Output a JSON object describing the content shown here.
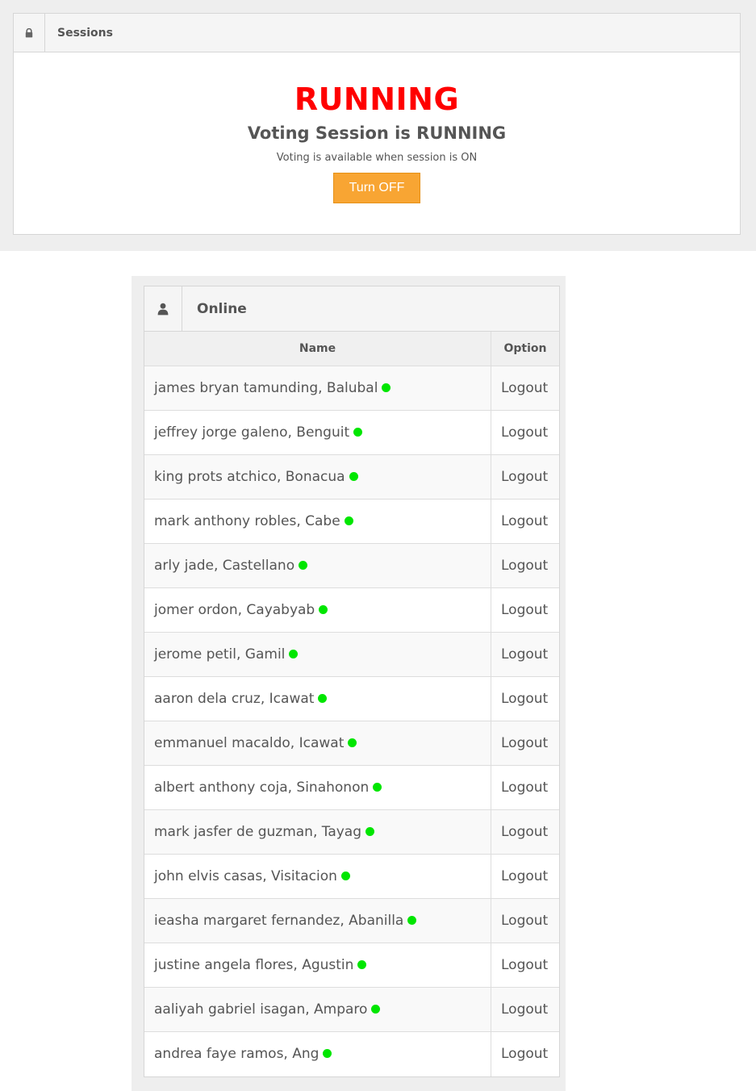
{
  "sessions": {
    "title": "Sessions",
    "status_big": "RUNNING",
    "status_line": "Voting Session is RUNNING",
    "hint": "Voting is available when session is ON",
    "toggle_label": "Turn OFF",
    "icon": "lock-icon"
  },
  "online": {
    "title": "Online",
    "icon": "user-icon",
    "columns": {
      "name": "Name",
      "option": "Option"
    },
    "rows": [
      {
        "name": "james bryan tamunding, Balubal",
        "option": "Logout"
      },
      {
        "name": "jeffrey jorge galeno, Benguit",
        "option": "Logout"
      },
      {
        "name": "king prots atchico, Bonacua",
        "option": "Logout"
      },
      {
        "name": "mark anthony robles, Cabe",
        "option": "Logout"
      },
      {
        "name": "arly jade, Castellano",
        "option": "Logout"
      },
      {
        "name": "jomer ordon, Cayabyab",
        "option": "Logout"
      },
      {
        "name": "jerome petil, Gamil",
        "option": "Logout"
      },
      {
        "name": "aaron dela cruz, Icawat",
        "option": "Logout"
      },
      {
        "name": "emmanuel macaldo, Icawat",
        "option": "Logout"
      },
      {
        "name": "albert anthony coja, Sinahonon",
        "option": "Logout"
      },
      {
        "name": "mark jasfer de guzman, Tayag",
        "option": "Logout"
      },
      {
        "name": "john elvis casas, Visitacion",
        "option": "Logout"
      },
      {
        "name": "ieasha margaret fernandez, Abanilla",
        "option": "Logout"
      },
      {
        "name": "justine angela flores, Agustin",
        "option": "Logout"
      },
      {
        "name": "aaliyah gabriel isagan, Amparo",
        "option": "Logout"
      },
      {
        "name": "andrea faye ramos, Ang",
        "option": "Logout"
      }
    ],
    "status_color": "#00e600"
  },
  "colors": {
    "running": "#ff0000",
    "button": "#f8a533"
  }
}
